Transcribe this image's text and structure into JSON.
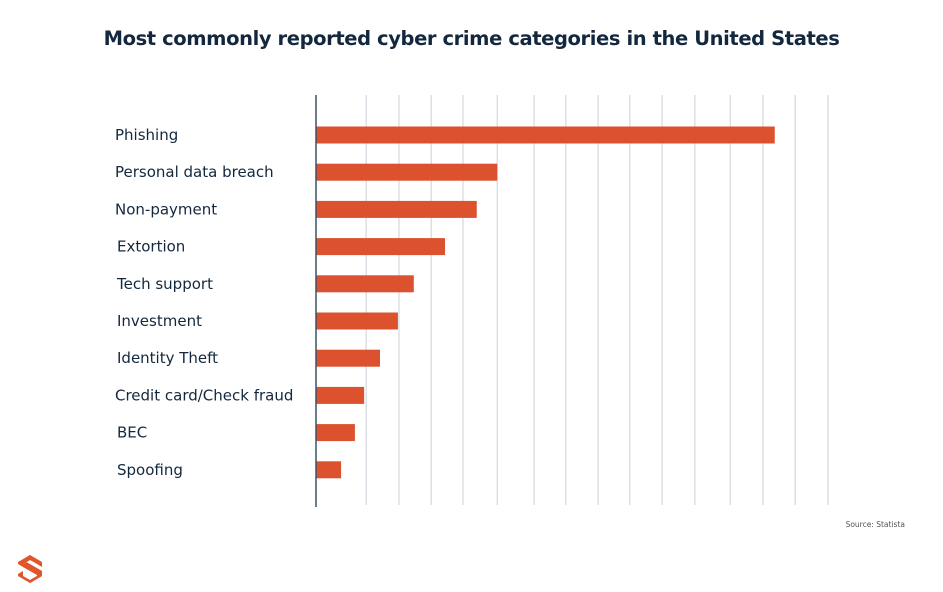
{
  "chart_data": {
    "type": "bar",
    "orientation": "horizontal",
    "title": "Most commonly reported cyber crime categories in the United States",
    "xlabel": "",
    "ylabel": "",
    "value_units": "relative (axis unlabeled; 0-100 scale estimated from bar lengths)",
    "xlim": [
      0,
      100
    ],
    "grid": true,
    "categories": [
      "Phishing",
      "Personal data breach",
      "Non-payment",
      "Extortion",
      "Tech support",
      "Investment",
      "Identity Theft",
      "Credit card/Check fraud",
      "BEC",
      "Spoofing"
    ],
    "values": [
      89.6,
      35.4,
      31.4,
      25.2,
      19.1,
      16.0,
      12.5,
      9.4,
      7.6,
      4.9
    ],
    "bar_color": "#dc512e",
    "source": "Source: Statista"
  },
  "logo": {
    "name": "brand-logo",
    "color": "#e0552c"
  }
}
